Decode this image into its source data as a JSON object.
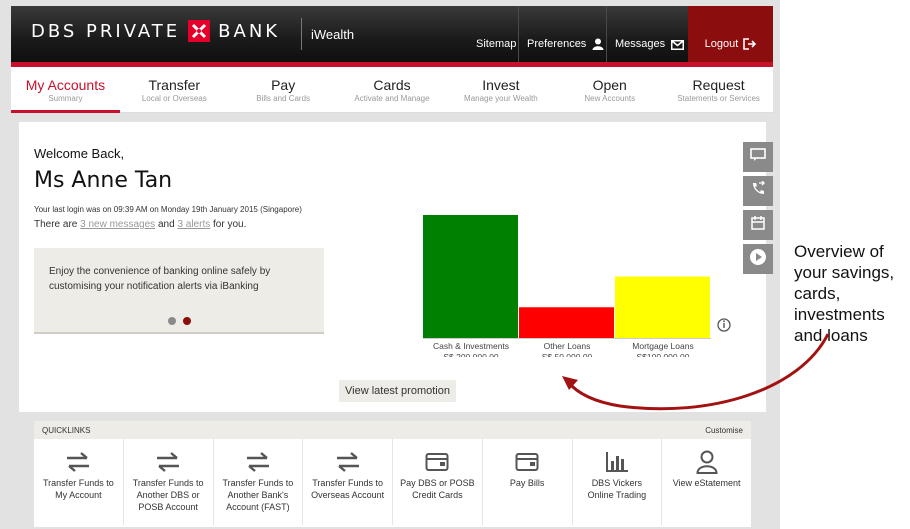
{
  "header": {
    "brand_left": "DBS PRIVATE",
    "brand_right": "BANK",
    "product": "iWealth",
    "links": [
      {
        "label": "Sitemap"
      },
      {
        "label": "Preferences",
        "icon": "user-icon"
      },
      {
        "label": "Messages",
        "icon": "mail-icon"
      }
    ],
    "logout": {
      "label": "Logout",
      "icon": "logout-icon"
    },
    "colors": {
      "brand_red": "#c8102e",
      "logout_bg": "#8b0d0d"
    }
  },
  "nav": {
    "items": [
      {
        "title": "My Accounts",
        "sub": "Summary",
        "active": true
      },
      {
        "title": "Transfer",
        "sub": "Local or Overseas"
      },
      {
        "title": "Pay",
        "sub": "Bills and Cards"
      },
      {
        "title": "Cards",
        "sub": "Activate and Manage"
      },
      {
        "title": "Invest",
        "sub": "Manage your Wealth"
      },
      {
        "title": "Open",
        "sub": "New Accounts"
      },
      {
        "title": "Request",
        "sub": "Statements or Services"
      }
    ]
  },
  "welcome": {
    "greeting": "Welcome Back,",
    "name": "Ms Anne Tan",
    "last_login": "Your last login was on 09:39 AM on Monday 19th January 2015 (Singapore)",
    "msg_prefix": "There are",
    "new_messages": "3 new messages",
    "msg_and": "and",
    "alerts": "3 alerts",
    "msg_suffix": "for you.",
    "promo_text": "Enjoy the convenience of banking online safely by customising your notification alerts via iBanking",
    "promo_button": "View latest promotion",
    "carousel": {
      "slides": 2,
      "active": 2
    }
  },
  "chart_data": {
    "type": "bar",
    "categories": [
      "Cash & Investments",
      "Other Loans",
      "Mortgage Loans"
    ],
    "value_labels": [
      "S$ 200,000.00",
      "S$ 50,000.00",
      "S$100,000.00"
    ],
    "values": [
      200000,
      50000,
      100000
    ],
    "colors": [
      "#008000",
      "#ff0000",
      "#ffff00"
    ],
    "ylim": [
      0,
      200000
    ],
    "grid": false
  },
  "side_icons": [
    "chat-icon",
    "phone-transfer-icon",
    "calendar-icon",
    "play-icon"
  ],
  "quicklinks": {
    "title": "QUICKLINKS",
    "customise": "Customise",
    "items": [
      {
        "label": "Transfer Funds to My Account",
        "icon": "transfer-arrows-icon"
      },
      {
        "label": "Transfer Funds to Another DBS or POSB Account",
        "icon": "transfer-arrows-icon"
      },
      {
        "label": "Transfer Funds to Another Bank's Account (FAST)",
        "icon": "transfer-arrows-icon"
      },
      {
        "label": "Transfer Funds to Overseas Account",
        "icon": "transfer-arrows-icon"
      },
      {
        "label": "Pay DBS or POSB Credit Cards",
        "icon": "wallet-icon"
      },
      {
        "label": "Pay Bills",
        "icon": "wallet-icon"
      },
      {
        "label": "DBS Vickers Online Trading",
        "icon": "bar-chart-icon"
      },
      {
        "label": "View eStatement",
        "icon": "person-icon"
      }
    ]
  },
  "annotation": {
    "lines": [
      "Overview of",
      "your savings,",
      "cards,",
      "investments",
      "and loans"
    ],
    "arrow_color": "#a31212"
  }
}
